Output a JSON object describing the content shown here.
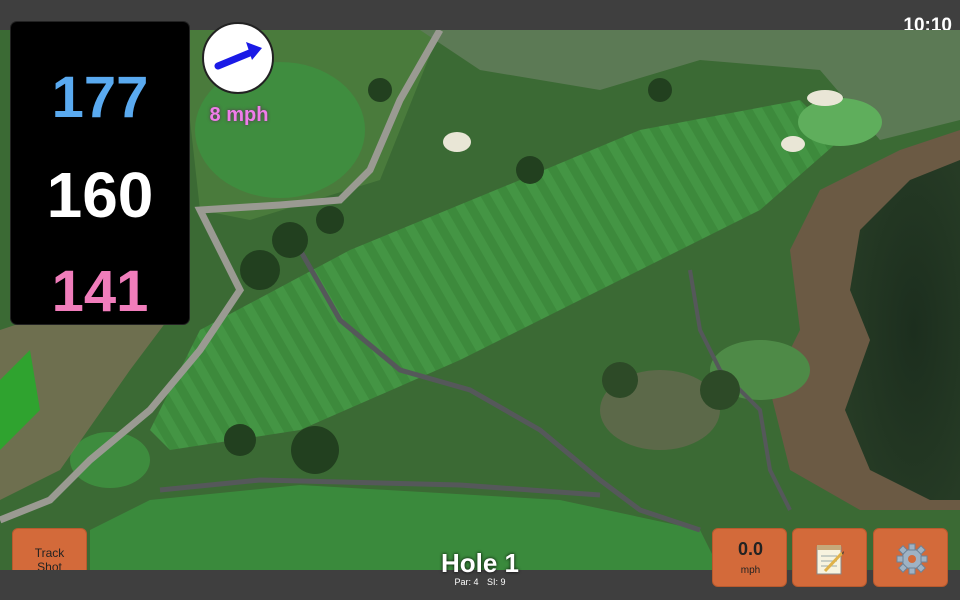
{
  "status_bar": {
    "time": "10:10"
  },
  "distances": {
    "back": "177",
    "middle": "160",
    "front": "141"
  },
  "wind": {
    "speed": "8 mph",
    "direction": "northeast",
    "arrow_color": "#1a1ae6"
  },
  "track_shot": {
    "label_line1": "Track",
    "label_line2": "Shot"
  },
  "speed_button": {
    "value": "0.0",
    "unit": "mph"
  },
  "notes_button": {
    "icon": "notepad-icon"
  },
  "settings_button": {
    "icon": "gear-icon"
  },
  "hole": {
    "title": "Hole 1",
    "par": "Par: 4",
    "si": "SI: 9"
  },
  "colors": {
    "back": "#5aaaf0",
    "middle": "#ffffff",
    "front": "#f07dbb",
    "button": "#d36a3a",
    "wind_text": "#f07dea"
  }
}
